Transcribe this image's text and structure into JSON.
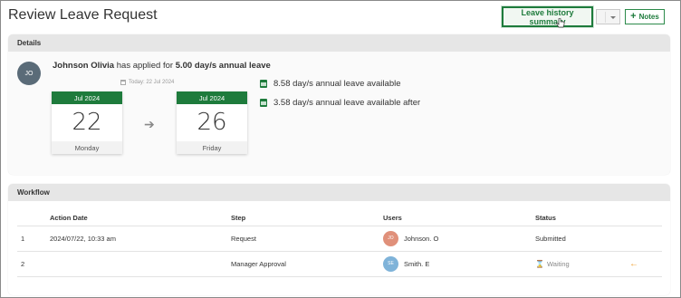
{
  "header": {
    "title": "Review Leave Request",
    "history_label": "Leave history summary",
    "notes_label": "Notes",
    "accent_color": "#1e7b3c"
  },
  "details": {
    "section_title": "Details",
    "avatar_initials": "JO",
    "employee_name": "Johnson Olivia",
    "applied_text": " has applied for ",
    "leave_amount": "5.00 day/s annual leave",
    "today_label": "Today: 22 Jul 2024",
    "start": {
      "month": "Jul 2024",
      "day": "22",
      "weekday": "Monday"
    },
    "end": {
      "month": "Jul 2024",
      "day": "26",
      "weekday": "Friday"
    },
    "available_now": "8.58 day/s annual leave available",
    "available_after": "3.58 day/s annual leave available after"
  },
  "workflow": {
    "section_title": "Workflow",
    "columns": [
      "Action Date",
      "Step",
      "Users",
      "Status"
    ],
    "rows": [
      {
        "num": "1",
        "date": "2024/07/22, 10:33 am",
        "step": "Request",
        "initials": "JO",
        "user": "Johnson. O",
        "avatar_color": "#e0907a",
        "status": "Submitted"
      },
      {
        "num": "2",
        "date": "",
        "step": "Manager Approval",
        "initials": "SE",
        "user": "Smith. E",
        "avatar_color": "#7fb3d9",
        "status": "Waiting"
      }
    ]
  }
}
